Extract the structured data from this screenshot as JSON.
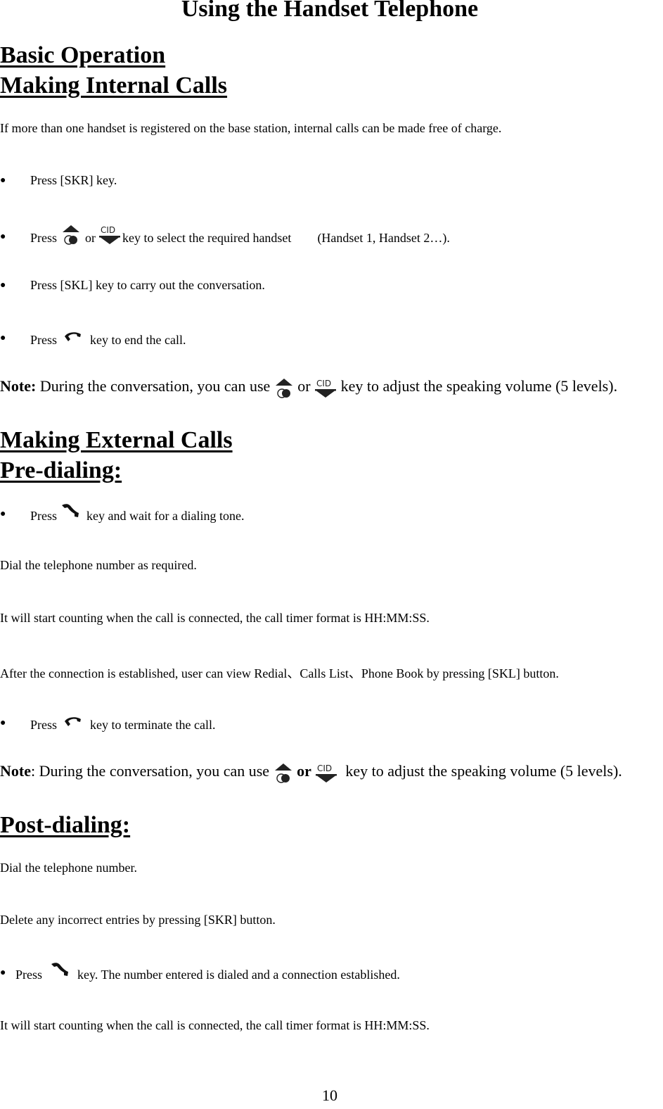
{
  "page": {
    "title": "Using the Handset Telephone",
    "page_number": "10"
  },
  "basic_operation": {
    "heading": "Basic Operation"
  },
  "internal_calls": {
    "heading": "Making Internal Calls",
    "intro": "If more than one handset is registered on the base station, internal calls can be made free of charge.",
    "steps": [
      {
        "text": "Press [SKR] key."
      },
      {
        "pre": "Press",
        "mid": "or",
        "post": "key to select the required handset",
        "extra": "(Handset 1, Handset 2…)."
      },
      {
        "text": "Press [SKL] key to carry out the conversation."
      },
      {
        "pre": "Press",
        "post": "key to end the call."
      }
    ],
    "note": {
      "label": "Note:",
      "pre": "During the conversation, you can use",
      "mid": "or",
      "post": "key to adjust the speaking volume (5 levels)."
    }
  },
  "external_calls": {
    "heading": "Making External Calls",
    "pre_dialing": {
      "heading": "Pre-dialing:",
      "step1": {
        "pre": "Press",
        "post": "key and wait for a dialing tone."
      },
      "para1": "Dial the telephone number as required.",
      "para2": "It will start counting when the call is connected, the call timer format is HH:MM:SS.",
      "para3": "After the connection is established, user can view Redial、Calls List、Phone Book by pressing [SKL] button.",
      "step2": {
        "pre": "Press",
        "post": "key to terminate the call."
      },
      "note": {
        "label": "Note",
        "colon": ":",
        "pre": " During the conversation, you can use",
        "mid": "or",
        "post": "key to adjust the speaking volume (5 levels)."
      }
    },
    "post_dialing": {
      "heading": "Post-dialing:",
      "para1": "Dial the telephone number.",
      "para2": "Delete any incorrect entries by pressing [SKR] button.",
      "step1": {
        "pre": "Press",
        "post": "key. The number entered is dialed and a connection established."
      },
      "para3": "It will start counting when the call is connected, the call timer format is HH:MM:SS."
    }
  },
  "icons": {
    "up_key": "up-arrow-intercom-key",
    "cid_down_key": "cid-down-arrow-key",
    "cid_label": "CID",
    "end_call": "end-call-handset",
    "talk": "talk-handset"
  }
}
